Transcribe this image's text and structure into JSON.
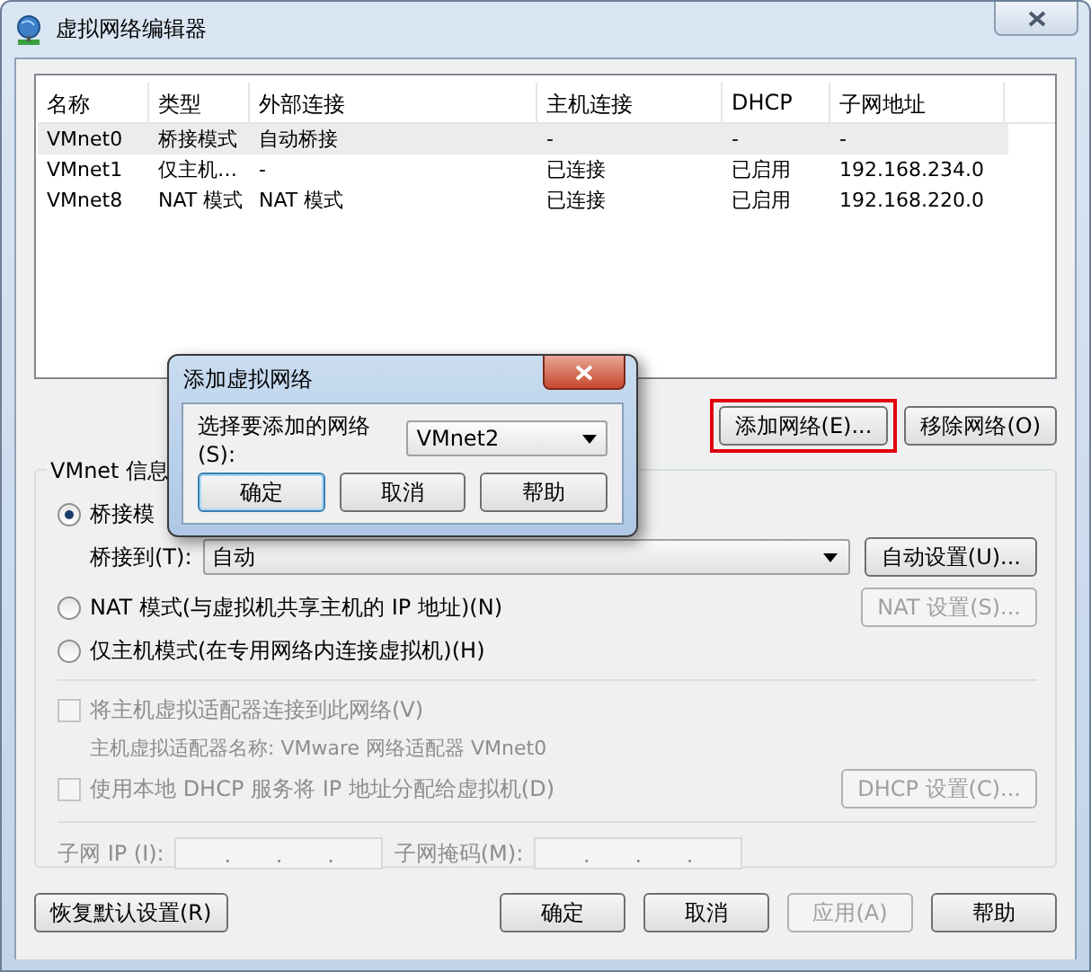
{
  "window": {
    "title": "虚拟网络编辑器"
  },
  "table": {
    "columns": [
      "名称",
      "类型",
      "外部连接",
      "主机连接",
      "DHCP",
      "子网地址"
    ],
    "rows": [
      {
        "cells": [
          "VMnet0",
          "桥接模式",
          "自动桥接",
          "-",
          "-",
          "-"
        ],
        "selected": true
      },
      {
        "cells": [
          "VMnet1",
          "仅主机…",
          "-",
          "已连接",
          "已启用",
          "192.168.234.0"
        ],
        "selected": false
      },
      {
        "cells": [
          "VMnet8",
          "NAT 模式",
          "NAT 模式",
          "已连接",
          "已启用",
          "192.168.220.0"
        ],
        "selected": false
      }
    ]
  },
  "network_buttons": [
    {
      "label": "添加网络(E)...",
      "highlighted": true,
      "disabled": false
    },
    {
      "label": "移除网络(O)",
      "highlighted": false,
      "disabled": false
    }
  ],
  "vmnet_info": {
    "title": "VMnet 信息",
    "modes": [
      {
        "label": "桥接模",
        "selected": true,
        "disabled": false
      },
      {
        "label": "NAT 模式(与虚拟机共享主机的 IP 地址)(N)",
        "selected": false,
        "disabled": false
      },
      {
        "label": "仅主机模式(在专用网络内连接虚拟机)(H)",
        "selected": false,
        "disabled": false
      }
    ],
    "bridge_to": {
      "label": "桥接到(T):",
      "value": "自动"
    },
    "auto_button": {
      "label": "自动设置(U)...",
      "disabled": false
    },
    "nat_button": {
      "label": "NAT 设置(S)...",
      "disabled": true
    },
    "host_adapter": {
      "label": "将主机虚拟适配器连接到此网络(V)",
      "checked": false,
      "disabled": true
    },
    "adapter_name": "主机虚拟适配器名称: VMware 网络适配器 VMnet0",
    "dhcp": {
      "label": "使用本地 DHCP 服务将 IP 地址分配给虚拟机(D)",
      "checked": false,
      "disabled": true
    },
    "dhcp_button": {
      "label": "DHCP 设置(C)...",
      "disabled": true
    },
    "subnet_fields": [
      {
        "label": "子网 IP (I):",
        "dots": [
          ".",
          ".",
          "."
        ],
        "disabled": true
      },
      {
        "label": "子网掩码(M):",
        "dots": [
          ".",
          ".",
          "."
        ],
        "disabled": true
      }
    ]
  },
  "footer_buttons": [
    {
      "label": "恢复默认设置(R)",
      "disabled": false
    },
    {
      "label": "确定",
      "disabled": false
    },
    {
      "label": "取消",
      "disabled": false
    },
    {
      "label": "应用(A)",
      "disabled": true
    },
    {
      "label": "帮助",
      "disabled": false
    }
  ],
  "dialog": {
    "title": "添加虚拟网络",
    "field_label": "选择要添加的网络(S):",
    "value": "VMnet2",
    "buttons": [
      {
        "label": "确定",
        "default": true
      },
      {
        "label": "取消",
        "default": false
      },
      {
        "label": "帮助",
        "default": false
      }
    ]
  }
}
